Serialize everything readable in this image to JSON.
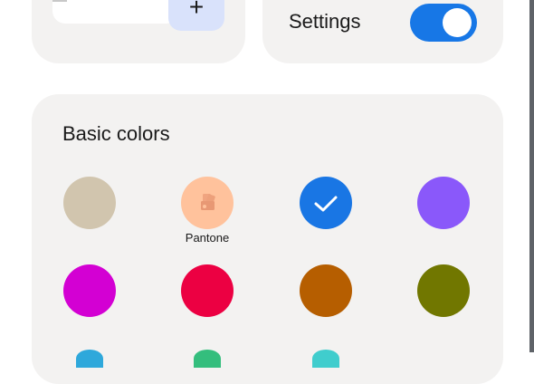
{
  "top_left_card": {
    "add_label": "+"
  },
  "settings_card": {
    "label": "Settings",
    "toggle_on": true
  },
  "basic_colors": {
    "title": "Basic colors",
    "swatches": [
      {
        "name": "beige",
        "color": "#d1c5ae",
        "label": "",
        "selected": false
      },
      {
        "name": "pantone",
        "color": "#ffc29c",
        "label": "Pantone",
        "selected": false,
        "icon": "swatch-book-icon"
      },
      {
        "name": "blue",
        "color": "#1976e4",
        "label": "",
        "selected": true,
        "icon": "check-icon"
      },
      {
        "name": "purple",
        "color": "#8a58fa",
        "label": "",
        "selected": false
      },
      {
        "name": "magenta",
        "color": "#d300d3",
        "label": "",
        "selected": false
      },
      {
        "name": "red",
        "color": "#ec0042",
        "label": "",
        "selected": false
      },
      {
        "name": "orange",
        "color": "#b65e00",
        "label": "",
        "selected": false
      },
      {
        "name": "olive",
        "color": "#717700",
        "label": "",
        "selected": false
      }
    ]
  }
}
